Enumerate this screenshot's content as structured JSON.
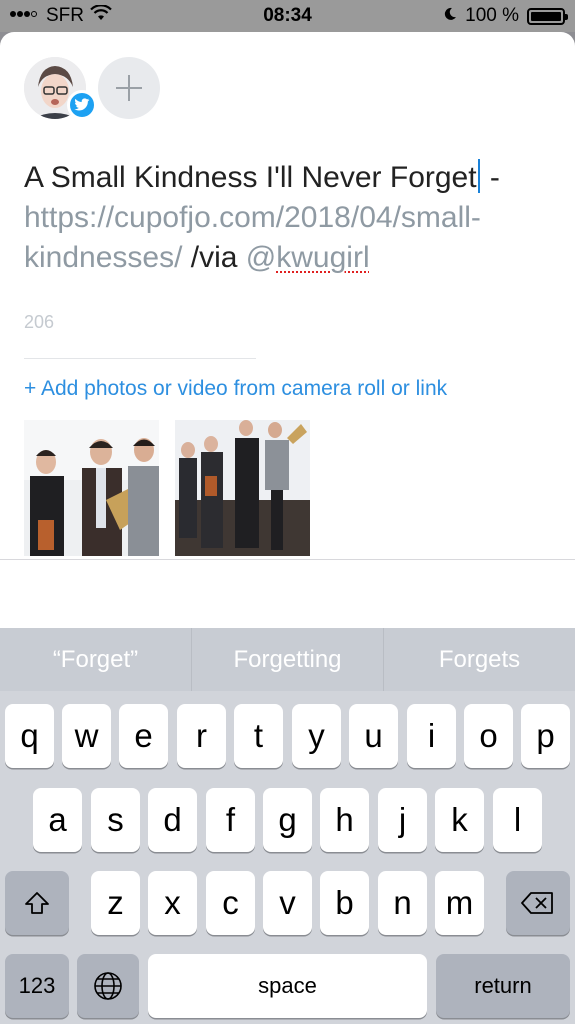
{
  "status_bar": {
    "carrier": "SFR",
    "time": "08:34",
    "battery": "100 %"
  },
  "compose": {
    "text_before_caret": "A Small Kindness I'll Never Forget",
    "text_after_caret": " -",
    "link": "https://cupofjo.com/2018/04/small-kindnesses/",
    "via_text": " /via ",
    "mention_at": "@",
    "mention_name": "kwugirl",
    "char_count": "206",
    "add_media_label": "+ Add photos or video from camera roll or link"
  },
  "keyboard": {
    "predictions": [
      "“Forget”",
      "Forgetting",
      "Forgets"
    ],
    "row1": [
      "q",
      "w",
      "e",
      "r",
      "t",
      "y",
      "u",
      "i",
      "o",
      "p"
    ],
    "row2": [
      "a",
      "s",
      "d",
      "f",
      "g",
      "h",
      "j",
      "k",
      "l"
    ],
    "row3": [
      "z",
      "x",
      "c",
      "v",
      "b",
      "n",
      "m"
    ],
    "numbers_key": "123",
    "space_key": "space",
    "return_key": "return"
  }
}
